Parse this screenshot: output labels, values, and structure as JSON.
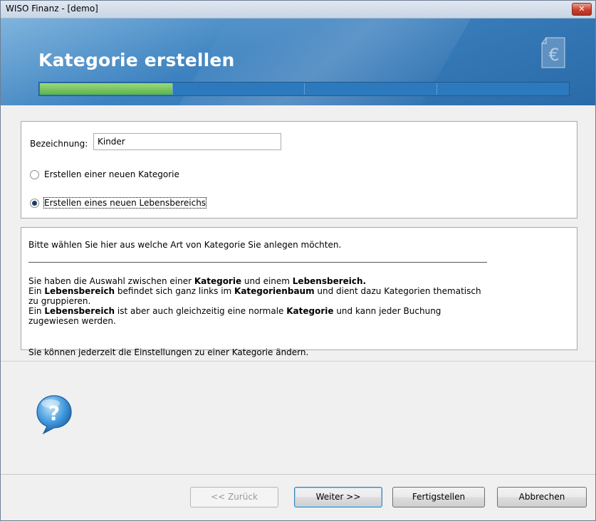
{
  "window": {
    "title": "WISO Finanz - [demo]",
    "close_glyph": "✕"
  },
  "header": {
    "title": "Kategorie erstellen",
    "icon": "euro-document-icon",
    "progress_percent": 25,
    "progress_segments": 4
  },
  "form": {
    "bezeichnung_label": "Bezeichnung:",
    "bezeichnung_value": "Kinder",
    "options": [
      {
        "label": "Erstellen einer neuen Kategorie",
        "checked": false
      },
      {
        "label": "Erstellen eines neuen Lebensbereichs",
        "checked": true
      }
    ]
  },
  "info": {
    "intro": "Bitte wählen Sie hier aus welche Art von Kategorie Sie anlegen möchten.",
    "line1_a": "Sie haben die Auswahl zwischen einer ",
    "line1_b": "Kategorie",
    "line1_c": " und einem ",
    "line1_d": "Lebensbereich.",
    "line2_a": "Ein ",
    "line2_b": "Lebensbereich",
    "line2_c": " befindet sich ganz links im ",
    "line2_d": "Kategorienbaum",
    "line2_e": " und dient dazu Kategorien thematisch zu gruppieren.",
    "line3_a": "Ein ",
    "line3_b": "Lebensbereich",
    "line3_c": " ist aber auch gleichzeitig eine normale ",
    "line3_d": "Kategorie",
    "line3_e": " und kann jeder Buchung zugewiesen werden.",
    "footer": "Sie können jederzeit die Einstellungen zu einer Kategorie ändern."
  },
  "help_icon": "question-bubble-icon",
  "buttons": {
    "back": "<< Zurück",
    "next": "Weiter >>",
    "finish": "Fertigstellen",
    "cancel": "Abbrechen"
  },
  "colors": {
    "header_blue": "#3d82c0",
    "progress_green": "#5db24a",
    "close_red": "#c8402c"
  }
}
